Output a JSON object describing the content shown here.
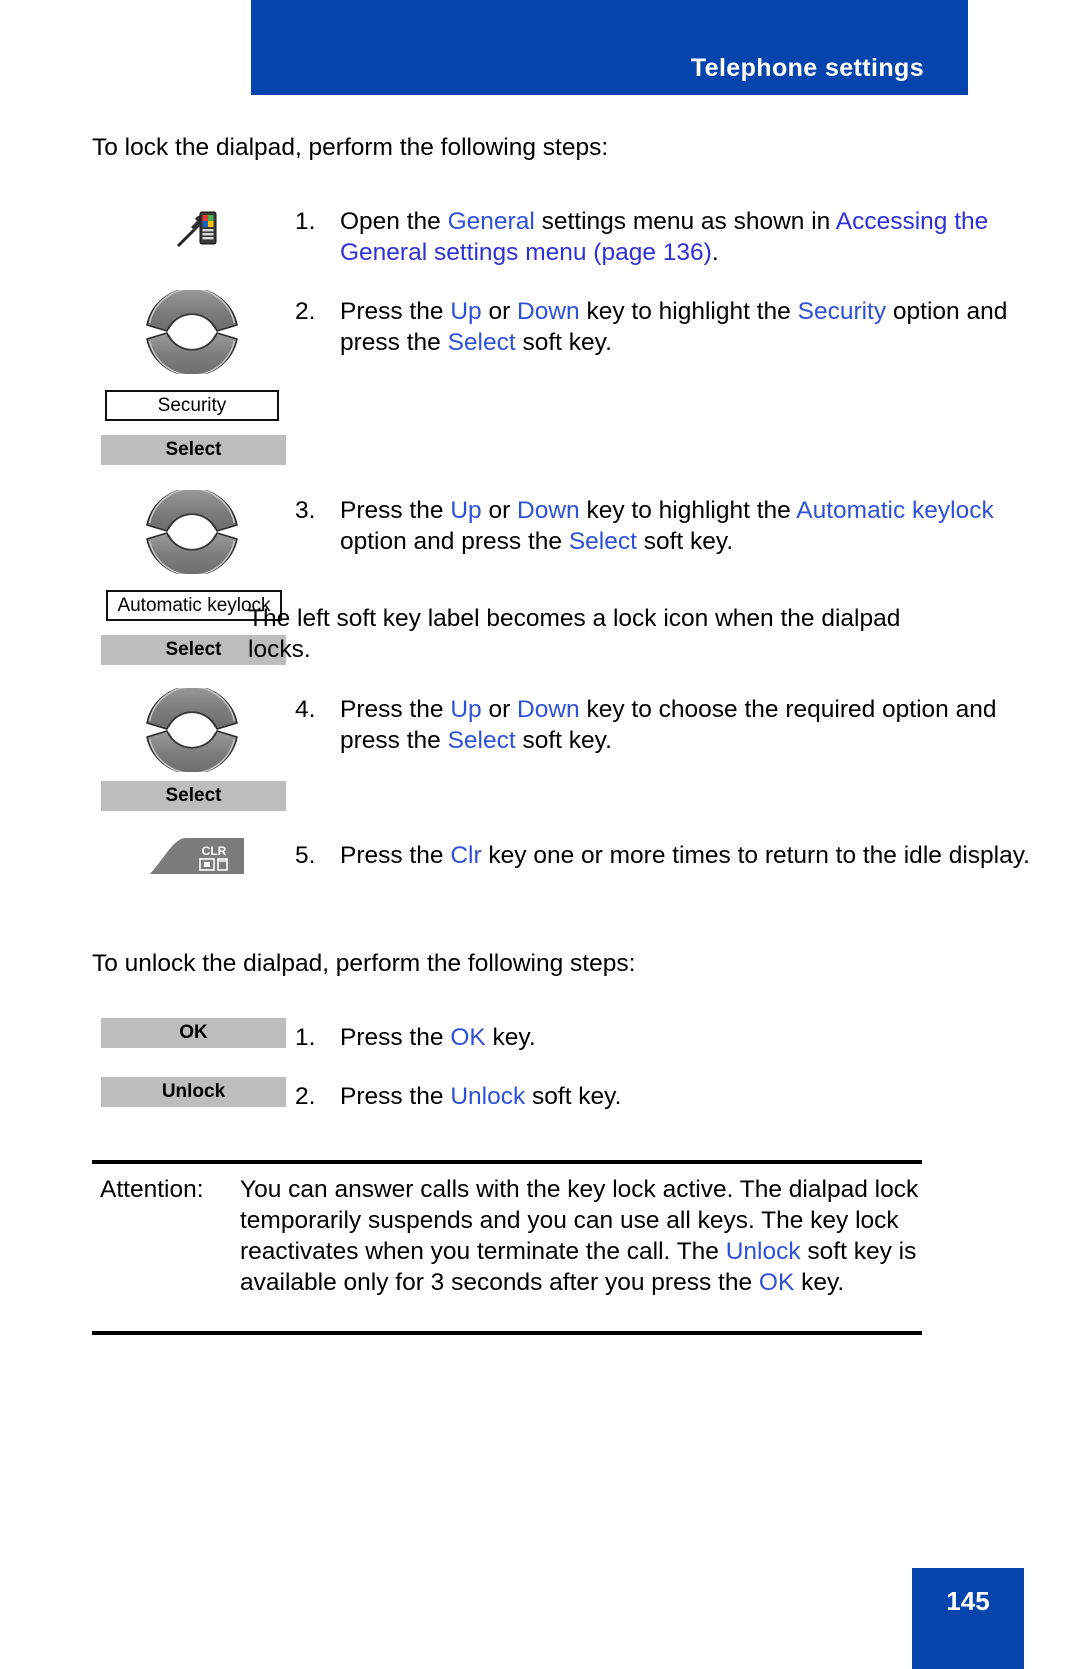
{
  "header": {
    "title": "Telephone settings"
  },
  "intro": {
    "lock": "To lock the dialpad, perform the following steps:",
    "unlock": "To unlock the dialpad, perform the following steps:"
  },
  "lock_steps": [
    {
      "number": "1.",
      "icon": "phone-settings-icon",
      "text_plain": "Open the General settings menu as shown in Accessing the General settings menu (page 136).",
      "parts": [
        {
          "t": "Open the ",
          "s": "plain"
        },
        {
          "t": "General",
          "s": "blue"
        },
        {
          "t": " settings menu as shown in ",
          "s": "plain"
        },
        {
          "t": "Accessing the General settings menu",
          "s": "link"
        },
        {
          "t": "  (page 136)",
          "s": "link"
        },
        {
          "t": ".",
          "s": "plain"
        }
      ]
    },
    {
      "number": "2.",
      "icon": "nav-updown-key-icon",
      "text_plain": "Press the Up or Down key to highlight the Security option and press the Select soft key.",
      "parts": [
        {
          "t": "Press the ",
          "s": "plain"
        },
        {
          "t": "Up",
          "s": "blue"
        },
        {
          "t": " or ",
          "s": "plain"
        },
        {
          "t": "Down",
          "s": "blue"
        },
        {
          "t": "  key to highlight the ",
          "s": "plain"
        },
        {
          "t": "Security",
          "s": "blue"
        },
        {
          "t": " option and press the ",
          "s": "plain"
        },
        {
          "t": "Select",
          "s": "blue"
        },
        {
          "t": "  soft key.",
          "s": "plain"
        }
      ],
      "label_box": "Security",
      "soft_key": "Select"
    },
    {
      "number": "3.",
      "icon": "nav-updown-key-icon",
      "text_plain": "Press the Up or Down key to highlight the Automatic keylock option and press the Select soft key.",
      "parts": [
        {
          "t": "Press the ",
          "s": "plain"
        },
        {
          "t": "Up",
          "s": "blue"
        },
        {
          "t": " or ",
          "s": "plain"
        },
        {
          "t": "Down",
          "s": "blue"
        },
        {
          "t": "  key to highlight the ",
          "s": "plain"
        },
        {
          "t": "Automatic keylock",
          "s": "blue"
        },
        {
          "t": "   option and press the ",
          "s": "plain"
        },
        {
          "t": "Select",
          "s": "blue"
        },
        {
          "t": " soft key.",
          "s": "plain"
        }
      ],
      "extra": "The left soft key label becomes a lock icon when the dialpad locks.",
      "label_box": "Automatic keylock",
      "soft_key": "Select"
    },
    {
      "number": "4.",
      "icon": "nav-updown-key-icon",
      "text_plain": "Press the Up or Down key to choose the required option and press the Select soft key.",
      "parts": [
        {
          "t": "Press the ",
          "s": "plain"
        },
        {
          "t": "Up",
          "s": "blue"
        },
        {
          "t": " or ",
          "s": "plain"
        },
        {
          "t": "Down",
          "s": "blue"
        },
        {
          "t": "  key to choose the required option and press the ",
          "s": "plain"
        },
        {
          "t": "Select",
          "s": "blue"
        },
        {
          "t": "  soft key.",
          "s": "plain"
        }
      ],
      "soft_key": "Select"
    },
    {
      "number": "5.",
      "icon": "clr-key-icon",
      "text_plain": "Press the Clr key one or more times to return to the idle display.",
      "parts": [
        {
          "t": "Press the ",
          "s": "plain"
        },
        {
          "t": "Clr",
          "s": "blue"
        },
        {
          "t": " key one or more times to return to the idle display.",
          "s": "plain"
        }
      ]
    }
  ],
  "unlock_steps": [
    {
      "number": "1.",
      "soft_key": "OK",
      "text_plain": "Press the OK key.",
      "parts": [
        {
          "t": "Press the ",
          "s": "plain"
        },
        {
          "t": "OK",
          "s": "blue"
        },
        {
          "t": " key.",
          "s": "plain"
        }
      ]
    },
    {
      "number": "2.",
      "soft_key": "Unlock",
      "text_plain": "Press the Unlock soft key.",
      "parts": [
        {
          "t": "Press the ",
          "s": "plain"
        },
        {
          "t": "Unlock",
          "s": "blue"
        },
        {
          "t": "  soft key.",
          "s": "plain"
        }
      ]
    }
  ],
  "attention": {
    "label": "Attention:",
    "text_plain": "You can answer calls with the key lock active. The dialpad lock temporarily suspends and you can use all keys. The key lock reactivates when you terminate the call. The Unlock soft key is available only for 3 seconds after you press the OK key.",
    "parts": [
      {
        "t": "You can answer calls with the key lock active. The dialpad lock temporarily suspends and you can use all keys. The key lock reactivates when you terminate the call. The ",
        "s": "plain"
      },
      {
        "t": "Unlock",
        "s": "blue"
      },
      {
        "t": "  soft key is available only for 3 seconds after you press the ",
        "s": "plain"
      },
      {
        "t": "OK",
        "s": "blue"
      },
      {
        "t": " key.",
        "s": "plain"
      }
    ]
  },
  "clr_key": {
    "label": "CLR"
  },
  "footer": {
    "page_number": "145"
  },
  "colors": {
    "brand_blue": "#0544AC",
    "text_blue": "#2E51D8",
    "softkey_gray": "#BDBDBD"
  }
}
